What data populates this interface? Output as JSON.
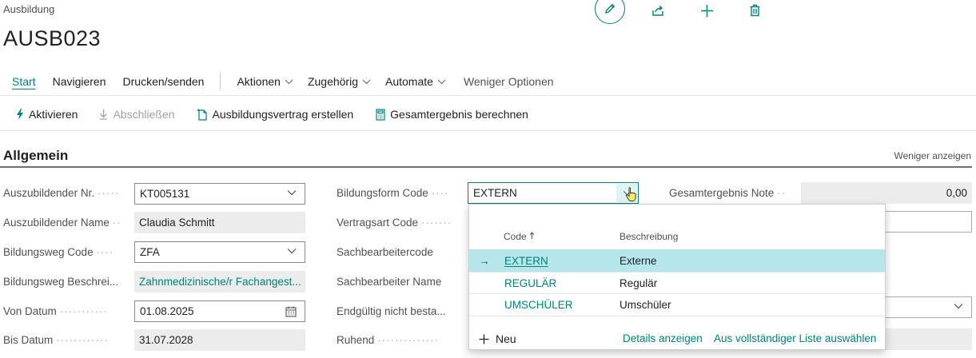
{
  "header": {
    "breadcrumb": "Ausbildung",
    "title": "AUSB023"
  },
  "menu": {
    "items": [
      "Start",
      "Navigieren",
      "Drucken/senden",
      "Aktionen",
      "Zugehörig",
      "Automate",
      "Weniger Optionen"
    ]
  },
  "actions": {
    "activate": "Aktivieren",
    "complete": "Abschließen",
    "create_contract": "Ausbildungsvertrag erstellen",
    "calc_total": "Gesamtergebnis berechnen"
  },
  "section": {
    "title": "Allgemein",
    "show_less": "Weniger anzeigen"
  },
  "fields": {
    "trainee_no_label": "Auszubildender Nr.",
    "trainee_no": "KT005131",
    "trainee_name_label": "Auszubildender Name",
    "trainee_name": "Claudia Schmitt",
    "path_code_label": "Bildungsweg Code",
    "path_code": "ZFA",
    "path_desc_label": "Bildungsweg Beschrei...",
    "path_desc": "Zahnmedizinische/r Fachangest...",
    "from_date_label": "Von Datum",
    "from_date": "01.08.2025",
    "to_date_label": "Bis Datum",
    "to_date": "31.07.2028",
    "form_code_label": "Bildungsform Code",
    "form_code": "EXTERN",
    "contract_type_label": "Vertragsart Code",
    "clerk_code_label": "Sachbearbeitercode",
    "clerk_name_label": "Sachbearbeiter Name",
    "final_failed_label": "Endgültig nicht besta...",
    "resting_label": "Ruhend",
    "total_grade_label": "Gesamtergebnis Note",
    "total_grade": "0,00"
  },
  "lookup": {
    "col_code": "Code",
    "col_desc": "Beschreibung",
    "rows": [
      {
        "code": "EXTERN",
        "desc": "Externe"
      },
      {
        "code": "REGULÄR",
        "desc": "Regulär"
      },
      {
        "code": "UMSCHÜLER",
        "desc": "Umschüler"
      }
    ],
    "new_label": "Neu",
    "details_label": "Details anzeigen",
    "select_full_label": "Aus vollständiger Liste auswählen"
  },
  "colors": {
    "accent": "#00817a",
    "selected_row": "#b5e6ec",
    "readonly_bg": "#ececec"
  }
}
